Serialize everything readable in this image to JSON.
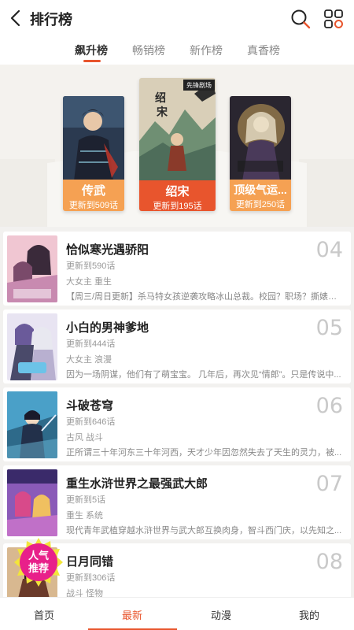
{
  "header": {
    "title": "排行榜",
    "icons": [
      "back-icon",
      "search-icon",
      "grid-icon"
    ]
  },
  "tabs": [
    {
      "label": "飙升榜",
      "active": true
    },
    {
      "label": "畅销榜",
      "active": false
    },
    {
      "label": "新作榜",
      "active": false
    },
    {
      "label": "真香榜",
      "active": false
    }
  ],
  "podium": {
    "first": {
      "name": "绍宋",
      "update": "更新到195话",
      "cover_text": "先锋剧场"
    },
    "second": {
      "name": "传武",
      "update": "更新到509话"
    },
    "third": {
      "name": "顶级气运...",
      "update": "更新到250话"
    }
  },
  "list": [
    {
      "name": "恰似寒光遇骄阳",
      "update": "更新到590话",
      "tags": "大女主  重生",
      "desc": "【周三/周日更新】杀马特女孩逆袭攻略冰山总裁。校园？职场？撕婊？...",
      "rank": "04"
    },
    {
      "name": "小白的男神爹地",
      "update": "更新到444话",
      "tags": "大女主  浪漫",
      "desc": "因为一场阴谋，他们有了萌宝宝。  几年后，再次见“情郎”。只是传说中...",
      "rank": "05"
    },
    {
      "name": "斗破苍穹",
      "update": "更新到646话",
      "tags": "古风  战斗",
      "desc": "正所谓三十年河东三十年河西，天才少年因忽然失去了天生的灵力，被...",
      "rank": "06"
    },
    {
      "name": "重生水浒世界之最强武大郎",
      "update": "更新到5话",
      "tags": "重生  系统",
      "desc": "现代青年武植穿越水浒世界与武大郎互换肉身，智斗西门庆，以先知之...",
      "rank": "07"
    },
    {
      "name": "日月同错",
      "update": "更新到306话",
      "tags": "战斗  怪物",
      "desc": "",
      "rank": "08"
    }
  ],
  "badge": {
    "line1": "人气",
    "line2": "推荐"
  },
  "bottom_nav": [
    {
      "label": "首页",
      "active": false
    },
    {
      "label": "最新",
      "active": true
    },
    {
      "label": "动漫",
      "active": false
    },
    {
      "label": "我的",
      "active": false
    }
  ],
  "colors": {
    "accent": "#e8552d",
    "label_orange": "#f5a153",
    "background": "#f2f1ef"
  }
}
